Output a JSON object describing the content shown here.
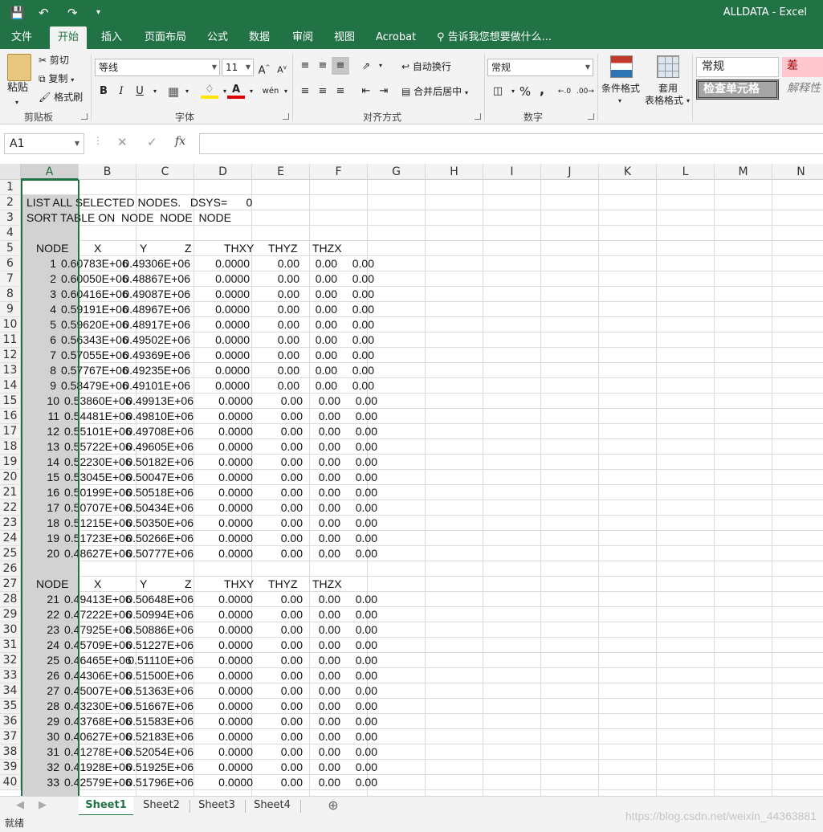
{
  "app": {
    "window_title": "ALLDATA - Excel"
  },
  "ribbon_tabs": [
    "文件",
    "开始",
    "插入",
    "页面布局",
    "公式",
    "数据",
    "审阅",
    "视图",
    "Acrobat"
  ],
  "tell_me": "告诉我您想要做什么...",
  "clipboard": {
    "paste": "粘贴",
    "cut": "剪切",
    "copy": "复制",
    "format_painter": "格式刷",
    "label": "剪贴板"
  },
  "font": {
    "name": "等线",
    "size": "11",
    "label": "字体",
    "wen": "wén"
  },
  "alignment": {
    "wrap": "自动换行",
    "merge": "合并后居中",
    "label": "对齐方式"
  },
  "number": {
    "format": "常规",
    "label": "数字",
    "percent": "%",
    "comma": ","
  },
  "styles": {
    "cond_format": "条件格式",
    "table_format_1": "套用",
    "table_format_2": "表格格式",
    "normal": "常规",
    "bad": "差",
    "check_cell": "检查单元格",
    "explanatory": "解释性"
  },
  "formula_bar": {
    "name_box": "A1",
    "fx": "fx",
    "content": ""
  },
  "columns": [
    "A",
    "B",
    "C",
    "D",
    "E",
    "F",
    "G",
    "H",
    "I",
    "J",
    "K",
    "L",
    "M",
    "N"
  ],
  "selected_column": "A",
  "rows": [
    "1",
    "2",
    "3",
    "4",
    "5",
    "6",
    "7",
    "8",
    "9",
    "10",
    "11",
    "12",
    "13",
    "14",
    "15",
    "16",
    "17",
    "18",
    "19",
    "20",
    "21",
    "22",
    "23",
    "24",
    "25",
    "26",
    "27",
    "28",
    "29",
    "30",
    "31",
    "32",
    "33",
    "34",
    "35",
    "36",
    "37",
    "38",
    "39",
    "40"
  ],
  "cells": [
    {
      "row": 2,
      "text": "LIST ALL SELECTED NODES.   DSYS=      0"
    },
    {
      "row": 3,
      "text": "SORT TABLE ON  NODE  NODE  NODE"
    },
    {
      "row": 5,
      "header": [
        "NODE",
        "X",
        "Y",
        "Z",
        "THXY",
        "THYZ",
        "THZX"
      ]
    },
    {
      "row": 6,
      "cols": [
        "1",
        "0.60783E+06",
        "0.49306E+06",
        "0.0000",
        "0.00",
        "0.00",
        "0.00"
      ]
    },
    {
      "row": 7,
      "cols": [
        "2",
        "0.60050E+06",
        "0.48867E+06",
        "0.0000",
        "0.00",
        "0.00",
        "0.00"
      ]
    },
    {
      "row": 8,
      "cols": [
        "3",
        "0.60416E+06",
        "0.49087E+06",
        "0.0000",
        "0.00",
        "0.00",
        "0.00"
      ]
    },
    {
      "row": 9,
      "cols": [
        "4",
        "0.59191E+06",
        "0.48967E+06",
        "0.0000",
        "0.00",
        "0.00",
        "0.00"
      ]
    },
    {
      "row": 10,
      "cols": [
        "5",
        "0.59620E+06",
        "0.48917E+06",
        "0.0000",
        "0.00",
        "0.00",
        "0.00"
      ]
    },
    {
      "row": 11,
      "cols": [
        "6",
        "0.56343E+06",
        "0.49502E+06",
        "0.0000",
        "0.00",
        "0.00",
        "0.00"
      ]
    },
    {
      "row": 12,
      "cols": [
        "7",
        "0.57055E+06",
        "0.49369E+06",
        "0.0000",
        "0.00",
        "0.00",
        "0.00"
      ]
    },
    {
      "row": 13,
      "cols": [
        "8",
        "0.57767E+06",
        "0.49235E+06",
        "0.0000",
        "0.00",
        "0.00",
        "0.00"
      ]
    },
    {
      "row": 14,
      "cols": [
        "9",
        "0.58479E+06",
        "0.49101E+06",
        "0.0000",
        "0.00",
        "0.00",
        "0.00"
      ]
    },
    {
      "row": 15,
      "cols": [
        "10",
        "0.53860E+06",
        "0.49913E+06",
        "0.0000",
        "0.00",
        "0.00",
        "0.00"
      ]
    },
    {
      "row": 16,
      "cols": [
        "11",
        "0.54481E+06",
        "0.49810E+06",
        "0.0000",
        "0.00",
        "0.00",
        "0.00"
      ]
    },
    {
      "row": 17,
      "cols": [
        "12",
        "0.55101E+06",
        "0.49708E+06",
        "0.0000",
        "0.00",
        "0.00",
        "0.00"
      ]
    },
    {
      "row": 18,
      "cols": [
        "13",
        "0.55722E+06",
        "0.49605E+06",
        "0.0000",
        "0.00",
        "0.00",
        "0.00"
      ]
    },
    {
      "row": 19,
      "cols": [
        "14",
        "0.52230E+06",
        "0.50182E+06",
        "0.0000",
        "0.00",
        "0.00",
        "0.00"
      ]
    },
    {
      "row": 20,
      "cols": [
        "15",
        "0.53045E+06",
        "0.50047E+06",
        "0.0000",
        "0.00",
        "0.00",
        "0.00"
      ]
    },
    {
      "row": 21,
      "cols": [
        "16",
        "0.50199E+06",
        "0.50518E+06",
        "0.0000",
        "0.00",
        "0.00",
        "0.00"
      ]
    },
    {
      "row": 22,
      "cols": [
        "17",
        "0.50707E+06",
        "0.50434E+06",
        "0.0000",
        "0.00",
        "0.00",
        "0.00"
      ]
    },
    {
      "row": 23,
      "cols": [
        "18",
        "0.51215E+06",
        "0.50350E+06",
        "0.0000",
        "0.00",
        "0.00",
        "0.00"
      ]
    },
    {
      "row": 24,
      "cols": [
        "19",
        "0.51723E+06",
        "0.50266E+06",
        "0.0000",
        "0.00",
        "0.00",
        "0.00"
      ]
    },
    {
      "row": 25,
      "cols": [
        "20",
        "0.48627E+06",
        "0.50777E+06",
        "0.0000",
        "0.00",
        "0.00",
        "0.00"
      ]
    },
    {
      "row": 27,
      "header": [
        "NODE",
        "X",
        "Y",
        "Z",
        "THXY",
        "THYZ",
        "THZX"
      ]
    },
    {
      "row": 28,
      "cols": [
        "21",
        "0.49413E+06",
        "0.50648E+06",
        "0.0000",
        "0.00",
        "0.00",
        "0.00"
      ]
    },
    {
      "row": 29,
      "cols": [
        "22",
        "0.47222E+06",
        "0.50994E+06",
        "0.0000",
        "0.00",
        "0.00",
        "0.00"
      ]
    },
    {
      "row": 30,
      "cols": [
        "23",
        "0.47925E+06",
        "0.50886E+06",
        "0.0000",
        "0.00",
        "0.00",
        "0.00"
      ]
    },
    {
      "row": 31,
      "cols": [
        "24",
        "0.45709E+06",
        "0.51227E+06",
        "0.0000",
        "0.00",
        "0.00",
        "0.00"
      ]
    },
    {
      "row": 32,
      "cols": [
        "25",
        "0.46465E+06",
        "0.51110E+06",
        "0.0000",
        "0.00",
        "0.00",
        "0.00"
      ]
    },
    {
      "row": 33,
      "cols": [
        "26",
        "0.44306E+06",
        "0.51500E+06",
        "0.0000",
        "0.00",
        "0.00",
        "0.00"
      ]
    },
    {
      "row": 34,
      "cols": [
        "27",
        "0.45007E+06",
        "0.51363E+06",
        "0.0000",
        "0.00",
        "0.00",
        "0.00"
      ]
    },
    {
      "row": 35,
      "cols": [
        "28",
        "0.43230E+06",
        "0.51667E+06",
        "0.0000",
        "0.00",
        "0.00",
        "0.00"
      ]
    },
    {
      "row": 36,
      "cols": [
        "29",
        "0.43768E+06",
        "0.51583E+06",
        "0.0000",
        "0.00",
        "0.00",
        "0.00"
      ]
    },
    {
      "row": 37,
      "cols": [
        "30",
        "0.40627E+06",
        "0.52183E+06",
        "0.0000",
        "0.00",
        "0.00",
        "0.00"
      ]
    },
    {
      "row": 38,
      "cols": [
        "31",
        "0.41278E+06",
        "0.52054E+06",
        "0.0000",
        "0.00",
        "0.00",
        "0.00"
      ]
    },
    {
      "row": 39,
      "cols": [
        "32",
        "0.41928E+06",
        "0.51925E+06",
        "0.0000",
        "0.00",
        "0.00",
        "0.00"
      ]
    },
    {
      "row": 40,
      "cols": [
        "33",
        "0.42579E+06",
        "0.51796E+06",
        "0.0000",
        "0.00",
        "0.00",
        "0.00"
      ]
    }
  ],
  "sheets": [
    "Sheet1",
    "Sheet2",
    "Sheet3",
    "Sheet4"
  ],
  "active_sheet": "Sheet1",
  "status": "就绪",
  "watermark": "https://blog.csdn.net/weixin_44363881",
  "colors": {
    "accent": "#217346",
    "bad_style_bg": "#ffc7ce",
    "bad_style_text": "#9c0006",
    "check_cell_bg": "#a5a5a5"
  }
}
